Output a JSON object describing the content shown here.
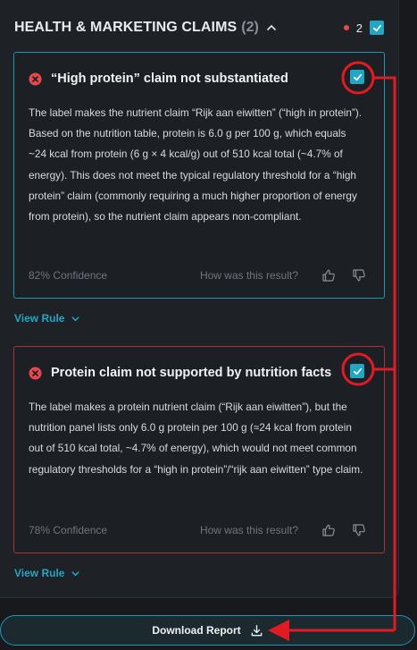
{
  "section": {
    "title": "HEALTH & MARKETING CLAIMS",
    "count": "(2)",
    "selected_count": "2"
  },
  "claims": [
    {
      "title": "“High protein” claim not substantiated",
      "body": "The label makes the nutrient claim “Rijk aan eiwitten” (“high in protein”). Based on the nutrition table, protein is 6.0 g per 100 g, which equals ~24 kcal from protein (6 g × 4 kcal/g) out of 510 kcal total (~4.7% of energy). This does not meet the typical regulatory threshold for a “high protein” claim (commonly requiring a much higher proportion of energy from protein), so the nutrient claim appears non-compliant.",
      "confidence": "82% Confidence",
      "feedback_question": "How was this result?",
      "view_rule": "View Rule"
    },
    {
      "title": "Protein claim not supported by nutrition facts",
      "body": "The label makes a protein nutrient claim (“Rijk aan eiwitten”), but the nutrition panel lists only 6.0 g protein per 100 g (≈24 kcal from protein out of 510 kcal total, ~4.7% of energy), which would not meet common regulatory thresholds for a “high in protein”/“rijk aan eiwitten” type claim.",
      "confidence": "78% Confidence",
      "feedback_question": "How was this result?",
      "view_rule": "View Rule"
    }
  ],
  "download": {
    "label": "Download Report"
  },
  "colors": {
    "accent": "#22a6c4",
    "error": "#e5484d",
    "annotation": "#e01b24"
  }
}
